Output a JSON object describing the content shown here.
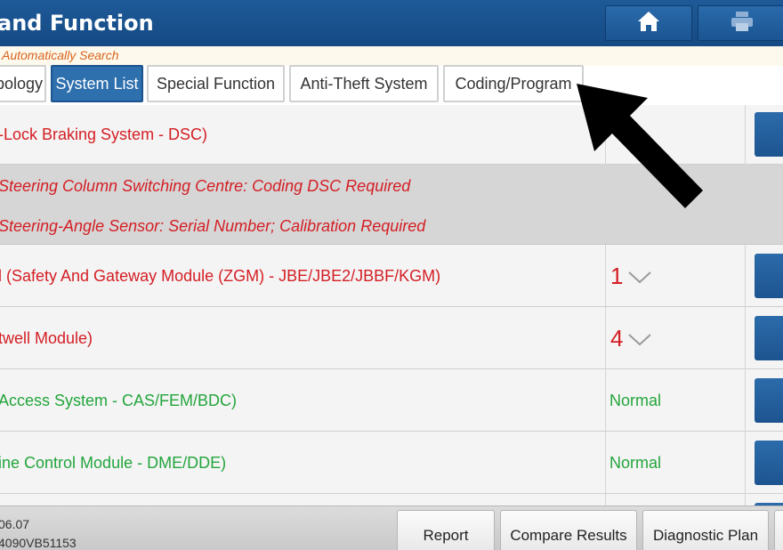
{
  "header": {
    "title": "and Function",
    "home_icon": "home-icon",
    "print_icon": "printer-icon",
    "bg_color": "#1a5290"
  },
  "auto_search": "Automatically Search",
  "tabs": [
    {
      "label": "pology",
      "active": false
    },
    {
      "label": "System List",
      "active": true
    },
    {
      "label": "Special Function",
      "active": false
    },
    {
      "label": "Anti-Theft System",
      "active": false
    },
    {
      "label": "Coding/Program",
      "active": false
    }
  ],
  "systems": [
    {
      "name": "-Lock Braking System - DSC)",
      "status_type": "fault",
      "expanded": true,
      "faults": [
        "Steering Column Switching Centre: Coding DSC Required",
        "Steering-Angle Sensor: Serial Number; Calibration Required"
      ]
    },
    {
      "name": "l (Safety And Gateway Module (ZGM) - JBE/JBE2/JBBF/KGM)",
      "status_type": "fault",
      "count": "1"
    },
    {
      "name": "twell Module)",
      "status_type": "fault",
      "count": "4"
    },
    {
      "name": "Access System - CAS/FEM/BDC)",
      "status_type": "ok",
      "status": "Normal"
    },
    {
      "name": "ine Control Module - DME/DDE)",
      "status_type": "ok",
      "status": "Normal"
    }
  ],
  "footer": {
    "version_line1": "06.07",
    "version_line2": "4090VB51153",
    "buttons": [
      "Report",
      "Compare Results",
      "Diagnostic Plan"
    ]
  },
  "colors": {
    "fault_red": "#d41e24",
    "normal_green": "#23a53c",
    "tab_active": "#2e6fae",
    "auto_search_orange": "#d9641e"
  }
}
